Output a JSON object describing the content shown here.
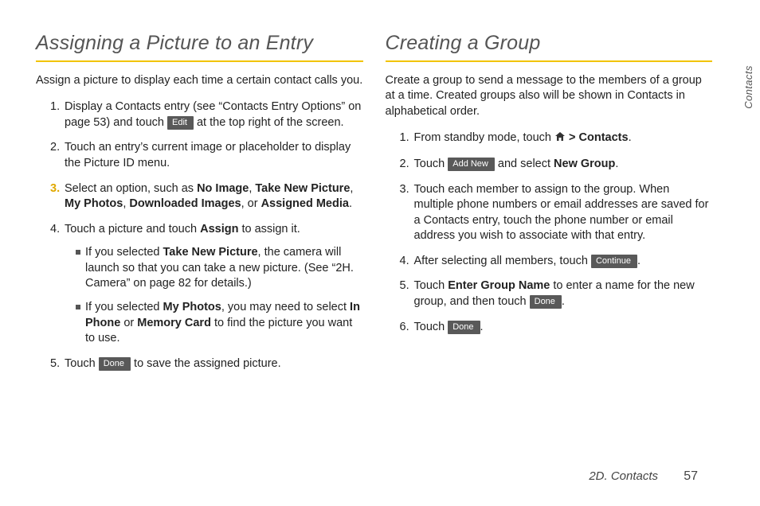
{
  "sideTab": "Contacts",
  "footer": {
    "section": "2D. Contacts",
    "page": "57"
  },
  "buttons": {
    "edit": "Edit",
    "done": "Done",
    "addNew": "Add New",
    "continue": "Continue"
  },
  "left": {
    "heading": "Assigning a Picture to an Entry",
    "intro": "Assign a picture to display each time a certain contact calls you.",
    "step1a": "Display a Contacts entry (see “Contacts Entry Options” on page 53) and touch ",
    "step1b": " at the top right of the screen.",
    "step2": "Touch an entry’s current image or placeholder to display the Picture ID menu.",
    "step3a": "Select an option, such as ",
    "opt1": "No Image",
    "sep": ", ",
    "opt2": "Take New Picture",
    "opt3": "My Photos",
    "opt4": "Downloaded Images",
    "sepOr": ", or ",
    "opt5": "Assigned Media",
    "step3end": ".",
    "step4a": "Touch a picture and touch ",
    "assign": "Assign",
    "step4b": " to assign it.",
    "sub1a": "If you selected ",
    "sub1b": ", the camera will launch so that  you can take a new picture. (See “2H. Camera” on page 82 for details.)",
    "sub2a": "If you selected ",
    "sub2b": ", you may need to select ",
    "inPhone": "In Phone",
    "or": " or ",
    "memCard": "Memory Card",
    "sub2c": " to find the picture you want to use.",
    "step5a": "Touch ",
    "step5b": " to save the assigned picture."
  },
  "right": {
    "heading": "Creating a Group",
    "intro": "Create a group to send a message to the members of a group at a time. Created groups also will be shown in Contacts in alphabetical order.",
    "step1a": "From standby mode, touch ",
    "step1gt": " > ",
    "contacts": "Contacts",
    "step1end": ".",
    "step2a": "Touch ",
    "step2b": " and select ",
    "newGroup": "New Group",
    "step2end": ".",
    "step3": "Touch each member to assign to the group. When multiple phone numbers or email addresses are saved for a Contacts entry, touch the phone number or email address you wish to associate with that entry.",
    "step4a": "After selecting all members, touch ",
    "step4end": ".",
    "step5a": "Touch ",
    "enterGroup": "Enter Group Name",
    "step5b": " to enter a name for the new group, and then touch ",
    "step5end": ".",
    "step6a": "Touch ",
    "step6end": "."
  }
}
